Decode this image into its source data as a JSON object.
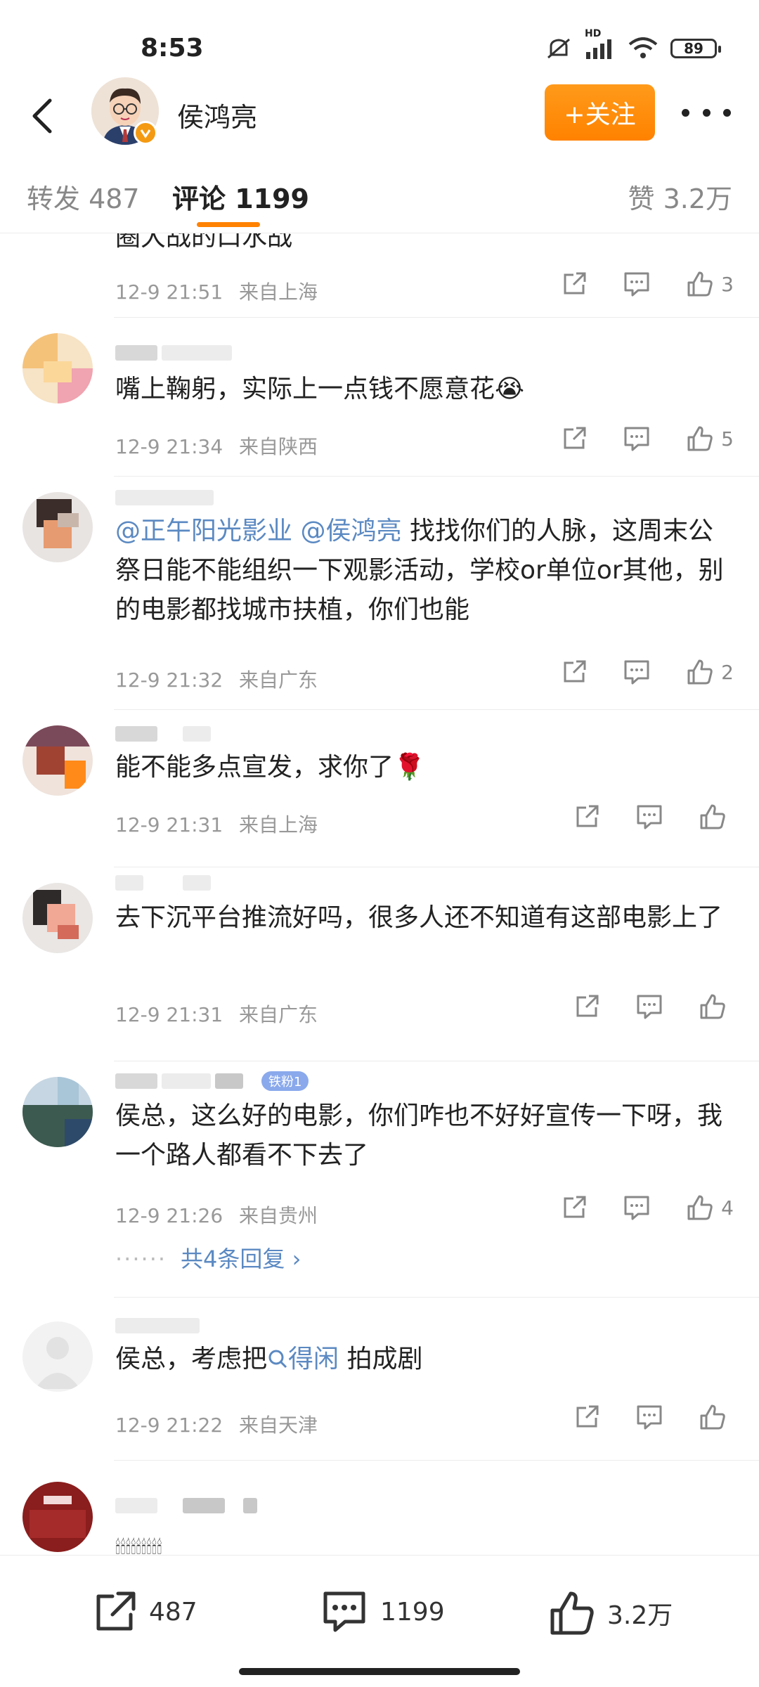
{
  "status_bar": {
    "time": "8:53",
    "battery": "89",
    "network_label": "HD"
  },
  "header": {
    "user_name": "侯鸿亮",
    "follow_label": "+关注"
  },
  "tabs": {
    "repost": "转发 487",
    "comment": "评论 1199",
    "like": "赞 3.2万"
  },
  "comments": [
    {
      "text": "圈大战的口水战",
      "time": "12-9 21:51",
      "location": "来自上海",
      "like_count": "3"
    },
    {
      "text": "嘴上鞠躬，实际上一点钱不愿意花😭",
      "time": "12-9 21:34",
      "location": "来自陕西",
      "like_count": "5"
    },
    {
      "mention1": "@正午阳光影业",
      "mention2": "@侯鸿亮",
      "text": " 找找你们的人脉，这周末公祭日能不能组织一下观影活动，学校or单位or其他，别的电影都找城市扶植，你们也能",
      "time": "12-9 21:32",
      "location": "来自广东",
      "like_count": "2"
    },
    {
      "text": "能不能多点宣发，求你了🌹",
      "time": "12-9 21:31",
      "location": "来自上海",
      "like_count": ""
    },
    {
      "text": "去下沉平台推流好吗，很多人还不知道有这部电影上了",
      "time": "12-9 21:31",
      "location": "来自广东",
      "like_count": ""
    },
    {
      "badge": "铁粉1",
      "text": "侯总，这么好的电影，你们咋也不好好宣传一下呀，我一个路人都看不下去了",
      "time": "12-9 21:26",
      "location": "来自贵州",
      "like_count": "4",
      "replies": "共4条回复 ›"
    },
    {
      "text_before": "侯总，考虑把",
      "search_term": "得闲",
      "text_after": " 拍成剧",
      "time": "12-9 21:22",
      "location": "来自天津",
      "like_count": ""
    },
    {
      "text": "🕯🕯🕯🕯🕯🕯🕯🕯🕯"
    }
  ],
  "bottom_bar": {
    "repost": "487",
    "comment": "1199",
    "like": "3.2万"
  },
  "colors": {
    "accent": "#ff8200",
    "link": "#5b89c2",
    "meta": "#999999"
  }
}
